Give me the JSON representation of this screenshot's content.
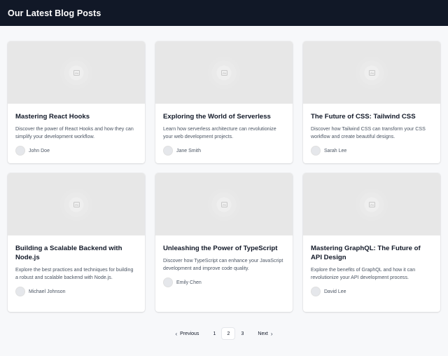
{
  "header": {
    "title": "Our Latest Blog Posts"
  },
  "posts": [
    {
      "title": "Mastering React Hooks",
      "description": "Discover the power of React Hooks and how they can simplify your development workflow.",
      "author": "John Doe"
    },
    {
      "title": "Exploring the World of Serverless",
      "description": "Learn how serverless architecture can revolutionize your web development projects.",
      "author": "Jane Smith"
    },
    {
      "title": "The Future of CSS: Tailwind CSS",
      "description": "Discover how Tailwind CSS can transform your CSS workflow and create beautiful designs.",
      "author": "Sarah Lee"
    },
    {
      "title": "Building a Scalable Backend with Node.js",
      "description": "Explore the best practices and techniques for building a robust and scalable backend with Node.js.",
      "author": "Michael Johnson"
    },
    {
      "title": "Unleashing the Power of TypeScript",
      "description": "Discover how TypeScript can enhance your JavaScript development and improve code quality.",
      "author": "Emily Chen"
    },
    {
      "title": "Mastering GraphQL: The Future of API Design",
      "description": "Explore the benefits of GraphQL and how it can revolutionize your API development process.",
      "author": "David Lee"
    }
  ],
  "pagination": {
    "previous_label": "Previous",
    "next_label": "Next",
    "pages": [
      "1",
      "2",
      "3"
    ],
    "current_page": "2"
  },
  "icons": {
    "thumbnail": "image-placeholder-icon",
    "previous": "chevron-left-icon",
    "next": "chevron-right-icon"
  },
  "colors": {
    "header_bg": "#111827",
    "card_bg": "#ffffff",
    "thumbnail_bg": "#e7e7e7",
    "page_bg": "#f7f8fa"
  }
}
